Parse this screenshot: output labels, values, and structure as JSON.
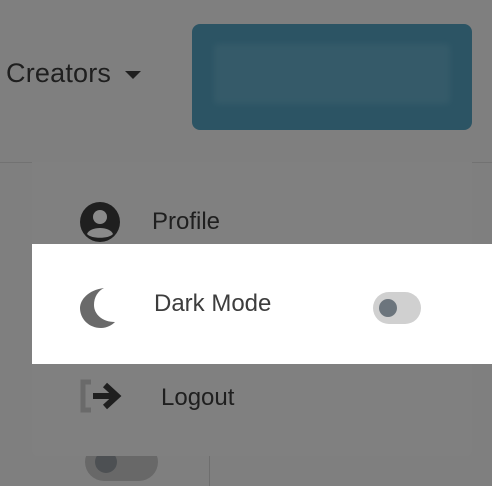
{
  "header": {
    "creators_label": "Creators"
  },
  "menu": {
    "profile_label": "Profile",
    "dark_mode_label": "Dark Mode",
    "dark_mode_enabled": false,
    "logout_label": "Logout"
  },
  "colors": {
    "cta": "#58a9c9",
    "text": "#3d3d3d",
    "overlay": "rgba(0,0,0,0.5)",
    "highlight": "#ffffff"
  },
  "icons": {
    "profile": "user-circle-icon",
    "dark_mode": "moon-icon",
    "logout": "sign-out-icon",
    "caret": "caret-down-icon"
  }
}
